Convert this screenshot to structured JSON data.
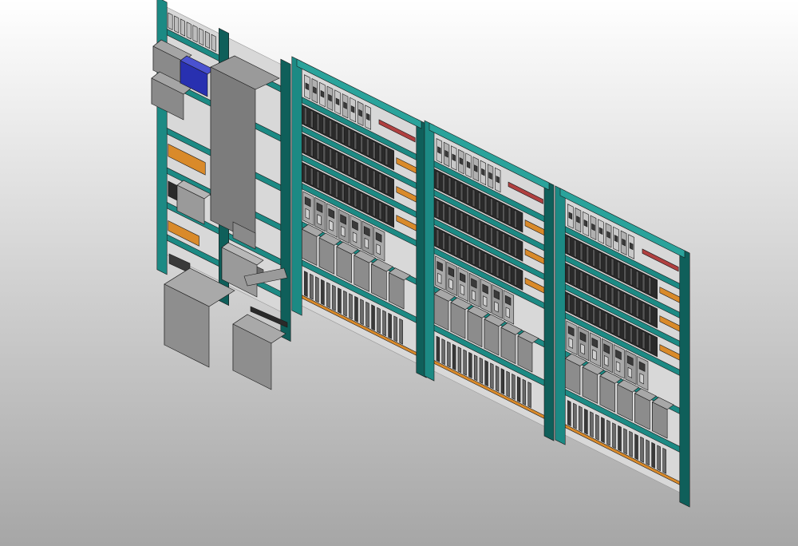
{
  "viewport": {
    "view_name": "",
    "projection": "isometric",
    "background_top": "#ffffff",
    "background_bottom": "#a6a6a6"
  },
  "colors": {
    "frame": "#1c8a84",
    "frame_dark": "#0f5f5a",
    "frame_light": "#2aa39b",
    "backplate": "#d8d8d8",
    "backplate_edge": "#9a9a9a",
    "rail_red": "#b04040",
    "rail_orange": "#d98a2a",
    "device_grey": "#808080",
    "device_light": "#b0b0b0",
    "device_dark": "#3a3a3a",
    "cable_duct": "#2a2a2a",
    "highlight_blue": "#2830b0",
    "enclosure": "#7a7a7a"
  },
  "cabinets": [
    {
      "id": "panel-1",
      "kind": "side-panel-with-pillar"
    },
    {
      "id": "panel-2",
      "kind": "distribution-panel"
    },
    {
      "id": "panel-3",
      "kind": "distribution-panel"
    },
    {
      "id": "panel-4",
      "kind": "distribution-panel"
    }
  ]
}
